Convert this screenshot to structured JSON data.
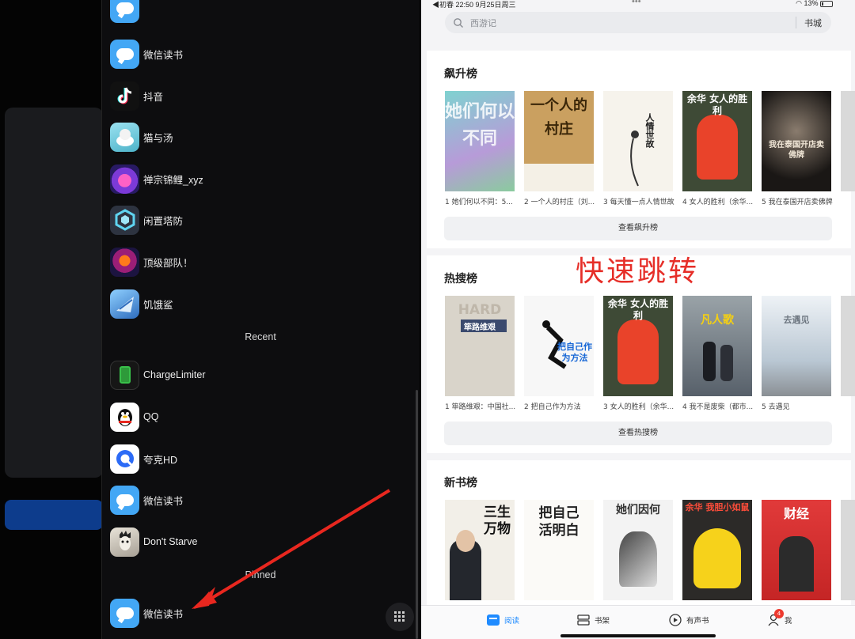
{
  "switcher": {
    "apps": [
      {
        "name": "微信读书",
        "icon": "weread-icon"
      },
      {
        "name": "抖音",
        "icon": "douyin-icon"
      },
      {
        "name": "猫与汤",
        "icon": "cat-soup-icon"
      },
      {
        "name": "禅宗锦鲤_xyz",
        "icon": "zen-koi-icon"
      },
      {
        "name": "闲置塔防",
        "icon": "idle-tower-defense-icon"
      },
      {
        "name": "顶级部队！",
        "icon": "top-troops-icon"
      },
      {
        "name": "饥饿鲨",
        "icon": "hungry-shark-icon"
      }
    ],
    "recent_label": "Recent",
    "recent": [
      {
        "name": "ChargeLimiter",
        "icon": "battery-icon"
      },
      {
        "name": "QQ",
        "icon": "qq-penguin-icon"
      },
      {
        "name": "夸克HD",
        "icon": "quark-icon"
      },
      {
        "name": "微信读书",
        "icon": "weread-icon"
      },
      {
        "name": "Don't Starve",
        "icon": "dont-starve-icon"
      }
    ],
    "pinned_label": "Pinned",
    "pinned": [
      {
        "name": "微信读书",
        "icon": "weread-icon"
      }
    ]
  },
  "weread": {
    "status": {
      "left": "◀初春   22:50  9月25日周三",
      "center": "•••",
      "right": "13%"
    },
    "search": {
      "placeholder": "西游记",
      "store_label": "书城"
    },
    "overlay_caption": "快速跳转",
    "sections": [
      {
        "title": "飙升榜",
        "more": "查看飙升榜",
        "books": [
          {
            "caption": "1 她们何以不同：5...",
            "cover_text": "她们何以不同"
          },
          {
            "caption": "2 一个人的村庄（刘...",
            "cover_text": "一个人的村庄"
          },
          {
            "caption": "3 每天懂一点人情世故",
            "cover_text": "人情世故"
          },
          {
            "caption": "4 女人的胜利（余华...",
            "cover_text": "余华 女人的胜利"
          },
          {
            "caption": "5 我在泰国开店卖佛牌",
            "cover_text": "我在泰国开店卖佛牌"
          }
        ]
      },
      {
        "title": "热搜榜",
        "more": "查看热搜榜",
        "books": [
          {
            "caption": "1 筚路维艰：中国社...",
            "cover_text": "筚路维艰"
          },
          {
            "caption": "2 把自己作为方法",
            "cover_text": "把自己作为方法"
          },
          {
            "caption": "3 女人的胜利（余华...",
            "cover_text": "余华 女人的胜利"
          },
          {
            "caption": "4 我不是废柴（都市...",
            "cover_text": "凡人歌"
          },
          {
            "caption": "5 去遇见",
            "cover_text": "去遇见"
          }
        ]
      },
      {
        "title": "新书榜",
        "books": [
          {
            "cover_text": "三生万物"
          },
          {
            "cover_text": "把自己 活明白"
          },
          {
            "cover_text": "她们因何"
          },
          {
            "cover_text": "余华 我胆小如鼠"
          },
          {
            "cover_text": "财经"
          }
        ]
      }
    ],
    "tabs": [
      {
        "label": "阅读",
        "icon": "read-icon",
        "active": true
      },
      {
        "label": "书架",
        "icon": "bookshelf-icon"
      },
      {
        "label": "有声书",
        "icon": "audiobook-icon"
      },
      {
        "label": "我",
        "icon": "profile-icon",
        "badge": "4"
      }
    ],
    "colors": {
      "accent": "#1f8bff",
      "overlay": "#e62e28",
      "arrow": "#e8271f"
    }
  }
}
